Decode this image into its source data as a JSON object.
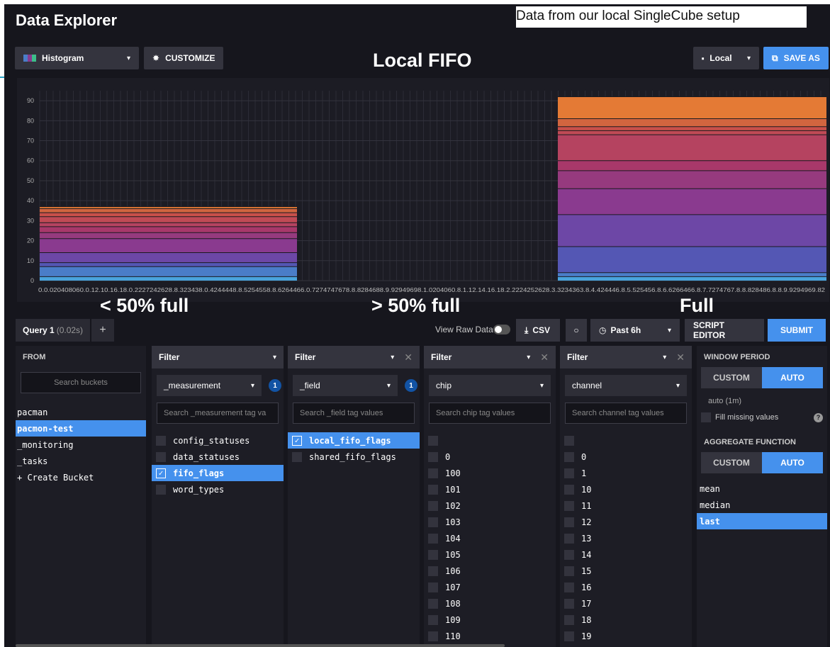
{
  "app": {
    "title": "Data Explorer"
  },
  "banner": "Data from our local SingleCube setup",
  "toolbar": {
    "vis_type": "Histogram",
    "customize": "CUSTOMIZE",
    "chart_title": "Local FIFO",
    "db": "Local",
    "save": "SAVE AS"
  },
  "annotations": {
    "low": "< 50% full",
    "mid": "> 50% full",
    "full": "Full"
  },
  "query": {
    "tab": "Query 1",
    "timing": "(0.02s)",
    "add": "+",
    "raw_label": "View Raw Data",
    "csv": "CSV",
    "time_range": "Past 6h",
    "script_editor": "SCRIPT EDITOR",
    "submit": "SUBMIT"
  },
  "from": {
    "header": "FROM",
    "search_placeholder": "Search buckets",
    "buckets": [
      "pacman",
      "pacmon-test",
      "_monitoring",
      "_tasks",
      "+ Create Bucket"
    ],
    "selected": "pacmon-test"
  },
  "filter1": {
    "header": "Filter",
    "key": "_measurement",
    "count": "1",
    "search_placeholder": "Search _measurement tag va",
    "values": [
      "config_statuses",
      "data_statuses",
      "fifo_flags",
      "word_types"
    ]
  },
  "filter2": {
    "header": "Filter",
    "key": "_field",
    "count": "1",
    "search_placeholder": "Search _field tag values",
    "values": [
      "local_fifo_flags",
      "shared_fifo_flags"
    ]
  },
  "filter3": {
    "header": "Filter",
    "key": "chip",
    "search_placeholder": "Search chip tag values",
    "values": [
      "",
      "0",
      "100",
      "101",
      "102",
      "103",
      "104",
      "105",
      "106",
      "107",
      "108",
      "109",
      "110"
    ]
  },
  "filter4": {
    "header": "Filter",
    "key": "channel",
    "search_placeholder": "Search channel tag values",
    "values": [
      "",
      "0",
      "1",
      "10",
      "11",
      "12",
      "13",
      "14",
      "15",
      "16",
      "17",
      "18",
      "19"
    ]
  },
  "window": {
    "window_header": "WINDOW PERIOD",
    "custom": "CUSTOM",
    "auto": "AUTO",
    "auto_value": "auto (1m)",
    "fill_missing": "Fill missing values",
    "help": "?",
    "agg_header": "AGGREGATE FUNCTION",
    "functions": [
      "mean",
      "median",
      "last"
    ],
    "selected": "last"
  },
  "chart_data": {
    "type": "bar",
    "title": "Local FIFO",
    "ylim": [
      0,
      95
    ],
    "yticks": [
      0,
      10,
      20,
      30,
      40,
      50,
      60,
      70,
      80,
      90
    ],
    "x_tick_text": "0.0.020408060.0.12.10.16.18.0.2227242628.8.323438.0.4244448.8.5254558.8.6264466.0.7274747678.8.8284688.9.92949698.1.0204060.8.1.12.14.16.18.2.2224252628.3.3234363.8.4.424446.8.5.525456.8.6.6266466.8.7.7274767.8.8.828486.8.8.9.9294969.82",
    "series": [
      {
        "values": [
          37,
          0,
          92
        ]
      },
      {
        "values": [
          36,
          0,
          81
        ]
      },
      {
        "values": [
          34,
          0,
          77
        ]
      },
      {
        "values": [
          32,
          0,
          75
        ]
      },
      {
        "values": [
          29,
          0,
          73
        ]
      },
      {
        "values": [
          27,
          0,
          60
        ]
      },
      {
        "values": [
          24,
          0,
          55
        ]
      },
      {
        "values": [
          21,
          0,
          46
        ]
      },
      {
        "values": [
          14,
          0,
          33
        ]
      },
      {
        "values": [
          9,
          0,
          17
        ]
      },
      {
        "values": [
          7,
          0,
          4
        ]
      },
      {
        "values": [
          2,
          0,
          2
        ]
      }
    ],
    "colors": [
      "#e47a35",
      "#d1653f",
      "#c8504a",
      "#c04a55",
      "#b54360",
      "#a8386a",
      "#963a7e",
      "#8a3a8f",
      "#6d47a6",
      "#5457b4",
      "#4a7dc8",
      "#49a3dc"
    ]
  }
}
